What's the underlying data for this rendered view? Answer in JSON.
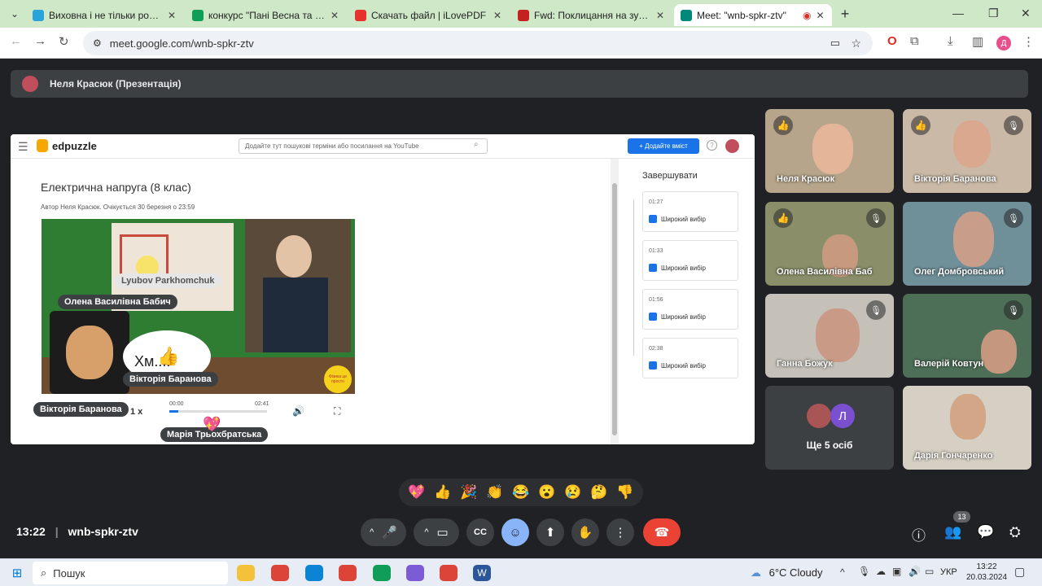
{
  "browser": {
    "tabs": [
      {
        "title": "Виховна і не тільки робота 👧",
        "color": "#2aa3d9"
      },
      {
        "title": "конкурс \"Пані Весна та Пан Ве",
        "color": "#0f9d58"
      },
      {
        "title": "Скачать файл | iLovePDF",
        "color": "#e5322d"
      },
      {
        "title": "Fwd: Поклицання на зустріч - ",
        "color": "#c5221f"
      },
      {
        "title": "Meet: \"wnb-spkr-ztv\"",
        "color": "#00897b"
      }
    ],
    "url": "meet.google.com/wnb-spkr-ztv"
  },
  "meet": {
    "presenter": "Неля Красюк (Презентація)",
    "meeting_code": "wnb-spkr-ztv",
    "time": "13:22",
    "participants_count": "13",
    "more_people": "Ще 5 осіб",
    "more_avatar_letter": "Л"
  },
  "edpuzzle": {
    "logo": "edpuzzle",
    "search_placeholder": "Додайте тут пошукові терміни або посилання на YouTube",
    "add_button": "+ Додайте вміст",
    "lesson_title": "Електрична напруга (8 клас)",
    "lesson_meta": "Автор Неля Красюк. Очікується 30 березня о 23:59",
    "side_header": "Завершувати",
    "questions": [
      {
        "time": "01:27",
        "type": "Широкий вибір"
      },
      {
        "time": "01:33",
        "type": "Широкий вибір"
      },
      {
        "time": "01:56",
        "type": "Широкий вибір"
      },
      {
        "time": "02:38",
        "type": "Широкий вибір"
      }
    ],
    "player": {
      "current": "00:00",
      "total": "02:41",
      "speed": "1 х",
      "progress": 0.09
    }
  },
  "overlays": {
    "name1": "Олена Василівна Бабич",
    "name2": "Вікторія Баранова",
    "name3": "Вікторія Баранова",
    "name4": "Марія Трьохбратська",
    "name5": "Lyubov Parkhomchuk",
    "bubble": "Хм....",
    "badge": "Фізика це просто"
  },
  "tiles": [
    {
      "name": "Неля Красюк",
      "hand": true,
      "muted": false,
      "bg": "#b6a58a"
    },
    {
      "name": "Вікторія Баранова",
      "hand": true,
      "muted": true,
      "bg": "#c9b9a6"
    },
    {
      "name": "Олена Василівна Баб",
      "hand": true,
      "muted": true,
      "bg": "#8a8f6a"
    },
    {
      "name": "Олег Домбровський",
      "hand": false,
      "muted": true,
      "bg": "#6f8f99"
    },
    {
      "name": "Ганна Божук",
      "hand": false,
      "muted": true,
      "bg": "#c5c0b8"
    },
    {
      "name": "Валерій Ковтун",
      "hand": false,
      "muted": true,
      "bg": "#4d6e57"
    },
    {
      "name": "Дарія Гончаренко",
      "hand": false,
      "muted": false,
      "bg": "#d6d0c4"
    }
  ],
  "reactions": [
    "💖",
    "👍",
    "🎉",
    "👏",
    "😂",
    "😮",
    "😢",
    "🤔",
    "👎"
  ],
  "taskbar": {
    "search": "Пошук",
    "weather": "6°C Cloudy",
    "lang": "УКР",
    "time": "13:22",
    "date": "20.03.2024"
  }
}
